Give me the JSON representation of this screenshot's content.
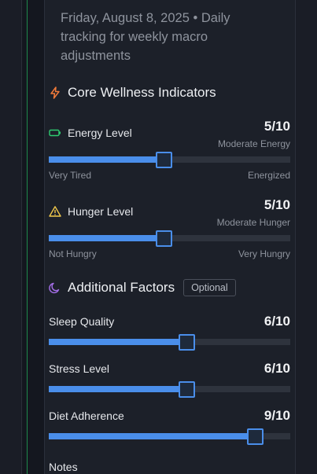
{
  "header": {
    "date_line": "Friday, August 8, 2025 • Daily tracking for weekly macro adjustments"
  },
  "core_section": {
    "title": "Core Wellness Indicators",
    "icon": "lightning-icon",
    "accent": "#f07a3a"
  },
  "energy": {
    "label": "Energy Level",
    "icon": "battery-icon",
    "icon_color": "#2ecc71",
    "score": "5/10",
    "description": "Moderate Energy",
    "value": 5,
    "max": 10,
    "min_label": "Very Tired",
    "max_label": "Energized"
  },
  "hunger": {
    "label": "Hunger Level",
    "icon": "warning-triangle-icon",
    "icon_color": "#f2c94c",
    "score": "5/10",
    "description": "Moderate Hunger",
    "value": 5,
    "max": 10,
    "min_label": "Not Hungry",
    "max_label": "Very Hungry"
  },
  "additional_section": {
    "title": "Additional Factors",
    "icon": "moon-icon",
    "accent": "#a46ee8",
    "badge": "Optional"
  },
  "sleep": {
    "label": "Sleep Quality",
    "score": "6/10",
    "value": 6,
    "max": 10
  },
  "stress": {
    "label": "Stress Level",
    "score": "6/10",
    "value": 6,
    "max": 10
  },
  "diet": {
    "label": "Diet Adherence",
    "score": "9/10",
    "value": 9,
    "max": 10
  },
  "notes": {
    "label": "Notes"
  },
  "colors": {
    "slider_fill": "#4a8eea",
    "slider_track": "#2e333d",
    "panel_bg": "#1c2029"
  }
}
